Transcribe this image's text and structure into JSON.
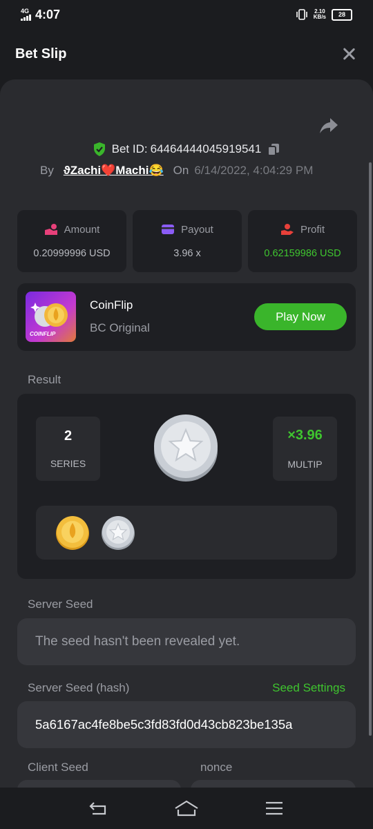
{
  "status_bar": {
    "network": "4G",
    "time": "4:07",
    "speed_value": "2.10",
    "speed_unit": "KB/s",
    "battery": "28"
  },
  "header": {
    "title": "Bet Slip"
  },
  "bet": {
    "id_label": "Bet ID:",
    "id": "64464444045919541",
    "by_label": "By",
    "user": "ϑZachi❤️Machi😂",
    "on_label": "On",
    "date": "6/14/2022, 4:04:29 PM"
  },
  "stats": {
    "amount": {
      "label": "Amount",
      "value": "0.20999996 USD"
    },
    "payout": {
      "label": "Payout",
      "value": "3.96 x"
    },
    "profit": {
      "label": "Profit",
      "value": "0.62159986 USD"
    }
  },
  "game": {
    "thumb_label": "COINFLIP",
    "name": "CoinFlip",
    "provider": "BC Original",
    "play_label": "Play Now"
  },
  "result": {
    "label": "Result",
    "series_value": "2",
    "series_label": "SERIES",
    "multiplier_value": "×3.96",
    "multiplier_label": "MULTIP",
    "history": [
      "gold-coin-icon",
      "silver-coin-icon"
    ]
  },
  "seeds": {
    "server_seed_label": "Server Seed",
    "server_seed_value": "The seed hasn't been revealed yet.",
    "server_hash_label": "Server Seed (hash)",
    "seed_settings_label": "Seed Settings",
    "server_hash_value": "5a6167ac4fe8be5c3fd83fd0d43cb823be135a",
    "client_seed_label": "Client Seed",
    "nonce_label": "nonce"
  },
  "colors": {
    "accent_green": "#3ab52b",
    "profit_green": "#3fc52f",
    "background": "#1b1c1f",
    "panel": "#2a2b2f"
  }
}
